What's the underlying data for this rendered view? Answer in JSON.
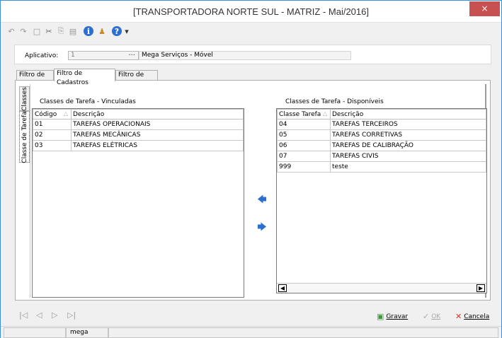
{
  "window": {
    "title": "[TRANSPORTADORA NORTE SUL -  MATRIZ - Mai/2016]",
    "close": "×"
  },
  "toolbar": {
    "icons": [
      "undo-icon",
      "redo-icon",
      "new-icon",
      "cut-icon",
      "copy-icon",
      "paste-icon",
      "info-icon",
      "user-icon",
      "help-icon",
      "dropdown-icon"
    ],
    "glyphs": [
      "↶",
      "↷",
      "□",
      "✂",
      "⎘",
      "▤",
      "i",
      "♟",
      "?",
      "▾"
    ]
  },
  "aplicativo": {
    "label": "Aplicativo:",
    "code": "1",
    "dots": "...",
    "description": "Mega Serviços - Móvel"
  },
  "tabs": [
    "Filtro de OS",
    "Filtro de Cadastros",
    "Filtro de Itens"
  ],
  "vertical_tabs": [
    "Classes",
    "Classe de Tarefa"
  ],
  "left_panel": {
    "title": "Classes de Tarefa - Vinculadas",
    "columns": [
      "Código",
      "Descrição"
    ],
    "rows": [
      [
        "01",
        "TAREFAS OPERACIONAIS"
      ],
      [
        "02",
        "TAREFAS MECÂNICAS"
      ],
      [
        "03",
        "TAREFAS ELÉTRICAS"
      ]
    ]
  },
  "right_panel": {
    "title": "Classes de Tarefa - Disponíveis",
    "columns": [
      "Classe Tarefa",
      "Descrição"
    ],
    "rows": [
      [
        "04",
        "TAREFAS TERCEIROS"
      ],
      [
        "05",
        "TAREFAS CORRETIVAS"
      ],
      [
        "06",
        "TAREFAS DE CALIBRAÇÃO"
      ],
      [
        "07",
        "TAREFAS CIVIS"
      ],
      [
        "999",
        "teste"
      ]
    ]
  },
  "transfer": {
    "left_arrow": "🡄",
    "right_arrow": "🡆"
  },
  "navigation": [
    "|◁",
    "◁",
    "▷",
    "▷|"
  ],
  "actions": {
    "gravar": "Gravar",
    "ok": "OK",
    "cancela": "Cancela"
  },
  "status_bar": {
    "user": "mega"
  },
  "colors": {
    "accent": "#2d6fcf",
    "close": "#c75050",
    "cancel": "#d93025",
    "save": "#3a9a3a"
  }
}
